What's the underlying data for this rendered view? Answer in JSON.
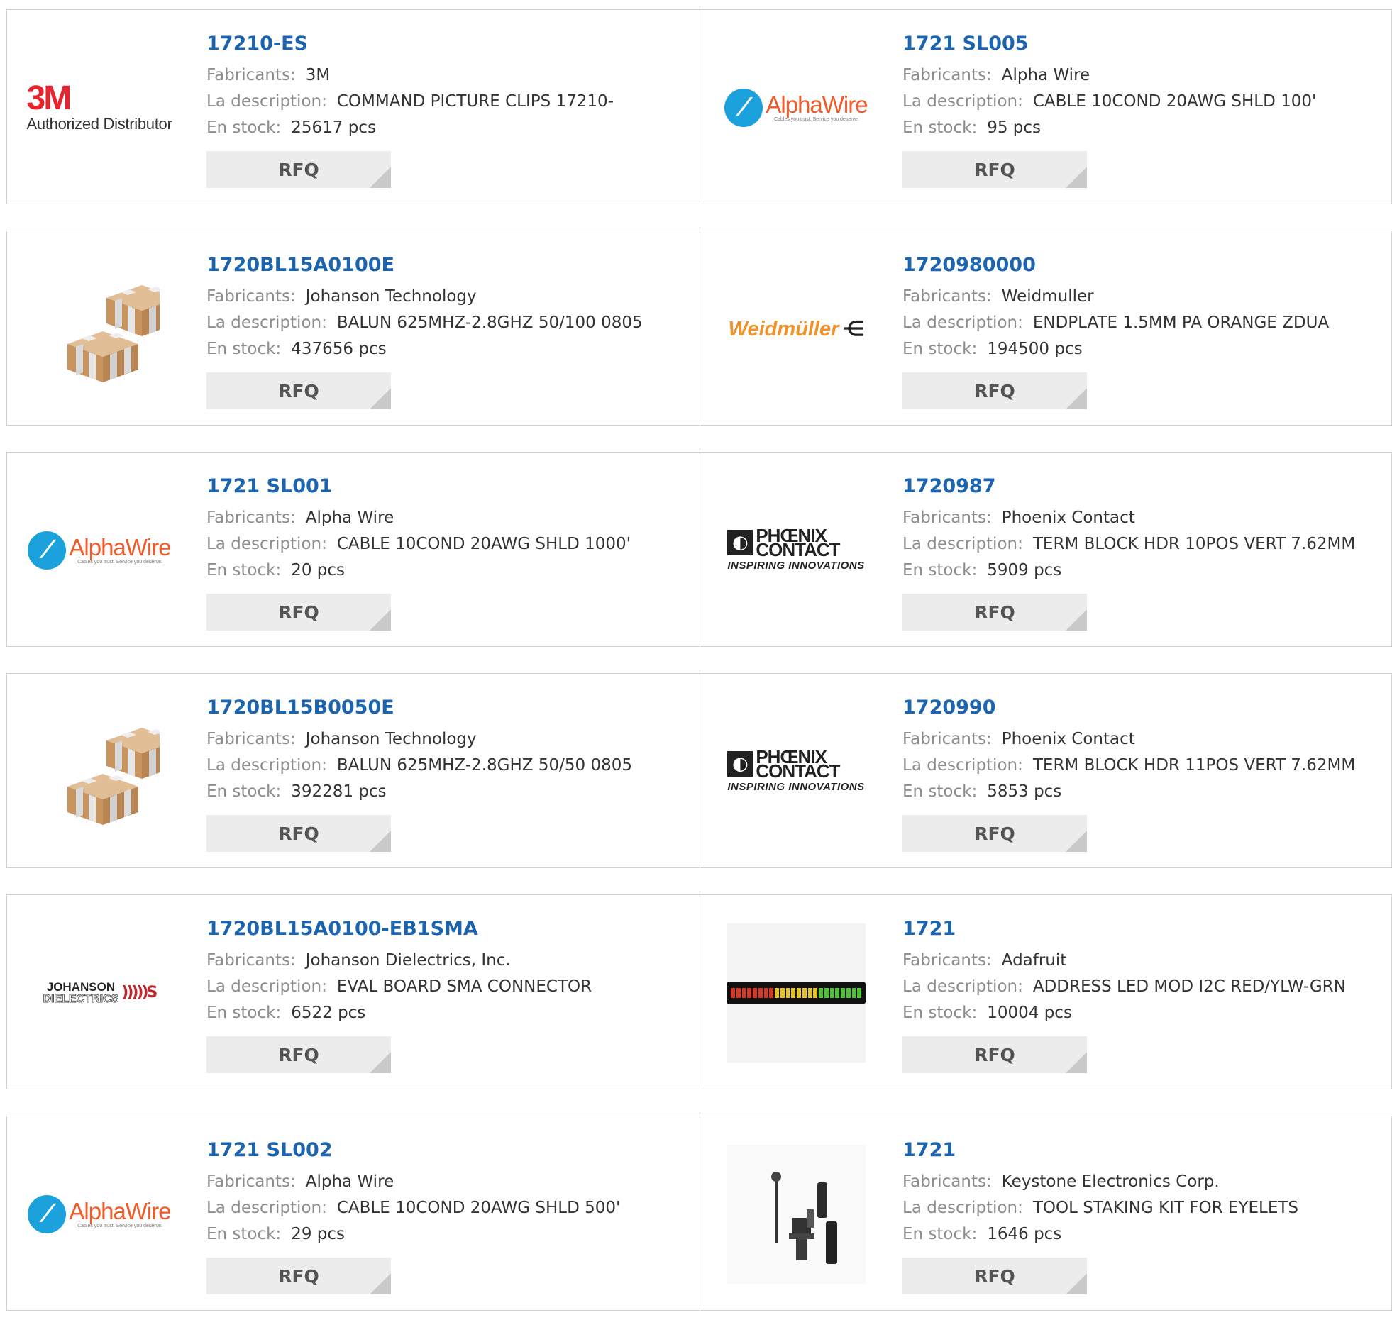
{
  "labels": {
    "manufacturer": "Fabricants:",
    "description": "La description:",
    "stock": "En stock:",
    "rfq": "RFQ"
  },
  "products": [
    {
      "part": "17210-ES",
      "manufacturer": "3M",
      "description": "COMMAND PICTURE CLIPS 17210-",
      "stock": "25617 pcs",
      "logo": "3m-logo",
      "logo_text": "3M",
      "logo_subtext": "Authorized Distributor"
    },
    {
      "part": "1721 SL005",
      "manufacturer": "Alpha Wire",
      "description": "CABLE 10COND 20AWG SHLD 100'",
      "stock": "95 pcs",
      "logo": "alphawire-logo",
      "logo_text": "AlphaWire",
      "logo_subtext": "Cables you trust. Service you deserve."
    },
    {
      "part": "1720BL15A0100E",
      "manufacturer": "Johanson Technology",
      "description": "BALUN 625MHZ-2.8GHZ 50/100 0805",
      "stock": "437656 pcs",
      "logo": "chip-component-image"
    },
    {
      "part": "1720980000",
      "manufacturer": "Weidmuller",
      "description": "ENDPLATE 1.5MM PA ORANGE ZDUA",
      "stock": "194500 pcs",
      "logo": "weidmuller-logo",
      "logo_text": "Weidmüller"
    },
    {
      "part": "1721 SL001",
      "manufacturer": "Alpha Wire",
      "description": "CABLE 10COND 20AWG SHLD 1000'",
      "stock": "20 pcs",
      "logo": "alphawire-logo",
      "logo_text": "AlphaWire",
      "logo_subtext": "Cables you trust. Service you deserve."
    },
    {
      "part": "1720987",
      "manufacturer": "Phoenix Contact",
      "description": "TERM BLOCK HDR 10POS VERT 7.62MM",
      "stock": "5909 pcs",
      "logo": "phoenix-contact-logo",
      "logo_text": "PHŒNIX CONTACT",
      "logo_subtext": "INSPIRING INNOVATIONS"
    },
    {
      "part": "1720BL15B0050E",
      "manufacturer": "Johanson Technology",
      "description": "BALUN 625MHZ-2.8GHZ 50/50 0805",
      "stock": "392281 pcs",
      "logo": "chip-component-image"
    },
    {
      "part": "1720990",
      "manufacturer": "Phoenix Contact",
      "description": "TERM BLOCK HDR 11POS VERT 7.62MM",
      "stock": "5853 pcs",
      "logo": "phoenix-contact-logo",
      "logo_text": "PHŒNIX CONTACT",
      "logo_subtext": "INSPIRING INNOVATIONS"
    },
    {
      "part": "1720BL15A0100-EB1SMA",
      "manufacturer": "Johanson Dielectrics, Inc.",
      "description": "EVAL BOARD SMA CONNECTOR",
      "stock": "6522 pcs",
      "logo": "johanson-dielectrics-logo",
      "logo_text": "JOHANSON",
      "logo_subtext": "DIELECTRICS"
    },
    {
      "part": "1721",
      "manufacturer": "Adafruit",
      "description": "ADDRESS LED MOD I2C RED/YLW-GRN",
      "stock": "10004 pcs",
      "logo": "led-bargraph-image"
    },
    {
      "part": "1721 SL002",
      "manufacturer": "Alpha Wire",
      "description": "CABLE 10COND 20AWG SHLD 500'",
      "stock": "29 pcs",
      "logo": "alphawire-logo",
      "logo_text": "AlphaWire",
      "logo_subtext": "Cables you trust. Service you deserve."
    },
    {
      "part": "1721",
      "manufacturer": "Keystone Electronics Corp.",
      "description": "TOOL STAKING KIT FOR EYELETS",
      "stock": "1646 pcs",
      "logo": "staking-kit-image"
    }
  ],
  "colors": {
    "part_link": "#1c64ad",
    "label": "#8c8c8c",
    "value": "#333333",
    "rfq_bg": "#ececec",
    "brand_3m": "#e4252e",
    "brand_alphawire": "#f15b2a",
    "brand_weidmuller": "#f0922b"
  }
}
